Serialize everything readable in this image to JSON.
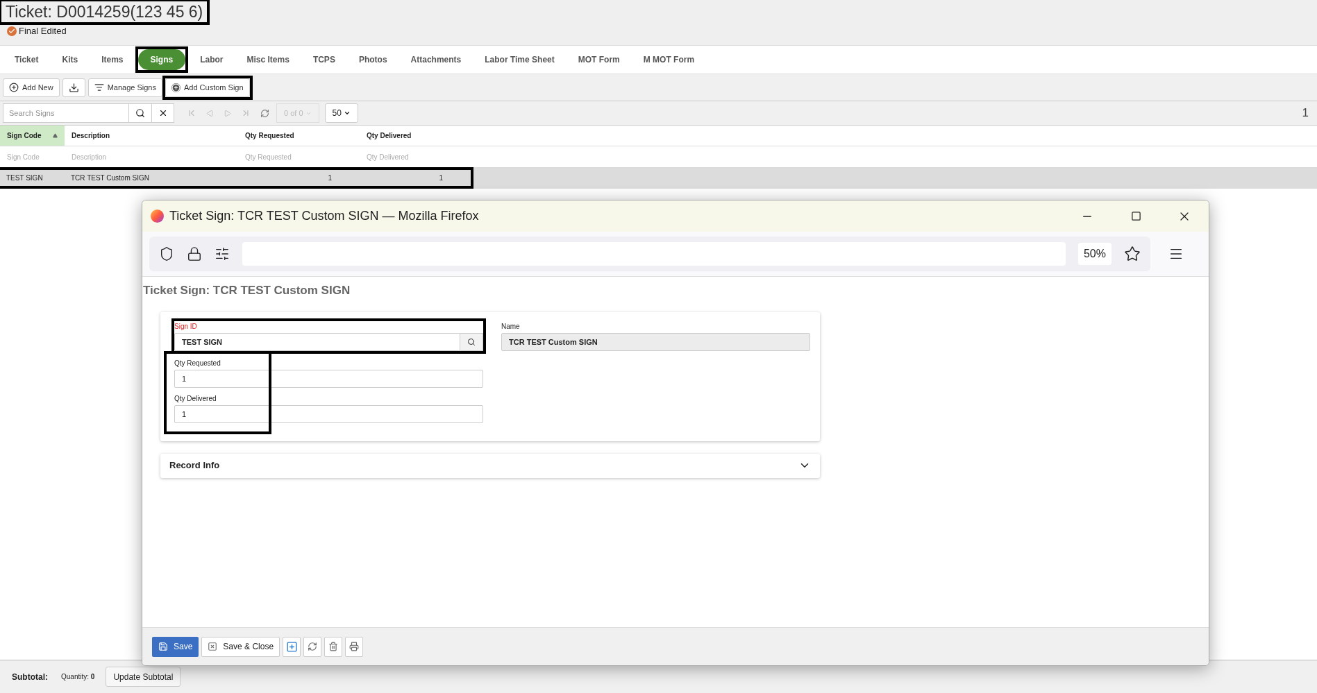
{
  "ticket": {
    "title": "Ticket: D0014259(123 45 6)",
    "highlighted": true,
    "status": "Final Edited"
  },
  "tabs": [
    {
      "label": "Ticket",
      "selected": false,
      "highlighted": false
    },
    {
      "label": "Kits",
      "selected": false,
      "highlighted": false
    },
    {
      "label": "Items",
      "selected": false,
      "highlighted": false
    },
    {
      "label": "Signs",
      "selected": true,
      "highlighted": true
    },
    {
      "label": "Labor",
      "selected": false,
      "highlighted": false
    },
    {
      "label": "Misc Items",
      "selected": false,
      "highlighted": false
    },
    {
      "label": "TCPS",
      "selected": false,
      "highlighted": false
    },
    {
      "label": "Photos",
      "selected": false,
      "highlighted": false
    },
    {
      "label": "Attachments",
      "selected": false,
      "highlighted": false
    },
    {
      "label": "Labor Time Sheet",
      "selected": false,
      "highlighted": false
    },
    {
      "label": "MOT Form",
      "selected": false,
      "highlighted": false
    },
    {
      "label": "M MOT Form",
      "selected": false,
      "highlighted": false
    }
  ],
  "toolbar": [
    {
      "kind": "add",
      "label": "Add New",
      "highlighted": false
    },
    {
      "kind": "download",
      "highlighted": false
    },
    {
      "kind": "manage",
      "label": "Manage Signs",
      "highlighted": false
    },
    {
      "kind": "add_custom",
      "label": "Add Custom Sign",
      "highlighted": true
    }
  ],
  "search": {
    "placeholder": "Search Signs"
  },
  "pager": {
    "range": "0 of 0",
    "page_size": "50",
    "page_number": "1"
  },
  "table": {
    "columns": [
      {
        "label": "Sign Code",
        "sorted": true
      },
      {
        "label": "Description",
        "sorted": false
      },
      {
        "label": "Qty Requested",
        "sorted": false
      },
      {
        "label": "Qty Delivered",
        "sorted": false
      }
    ],
    "filters": [
      {
        "placeholder": "Sign Code"
      },
      {
        "placeholder": "Description"
      },
      {
        "placeholder": "Qty Requested"
      },
      {
        "placeholder": "Qty Delivered"
      }
    ],
    "rows": [
      {
        "cells": [
          "TEST SIGN",
          "TCR TEST Custom SIGN",
          "1",
          "1"
        ],
        "selected": true,
        "highlighted": true
      }
    ]
  },
  "popup": {
    "window_title": "Ticket Sign: TCR TEST Custom SIGN — Mozilla Firefox",
    "zoom": "50%",
    "heading": "Ticket Sign: TCR TEST Custom SIGN",
    "sign_id": {
      "label": "Sign ID",
      "value": "TEST SIGN",
      "required": true,
      "highlighted": true
    },
    "name": {
      "label": "Name",
      "value": "TCR TEST Custom SIGN",
      "readonly": true
    },
    "quantities": {
      "highlighted": true,
      "fields": [
        {
          "label": "Qty Requested",
          "value": "1"
        },
        {
          "label": "Qty Delivered",
          "value": "1"
        }
      ]
    },
    "sections": [
      {
        "title": "Record Info",
        "expanded": false
      }
    ],
    "buttons": [
      {
        "kind": "save",
        "label": "Save"
      },
      {
        "kind": "save_close",
        "label": "Save & Close"
      },
      {
        "kind": "add"
      },
      {
        "kind": "refresh"
      },
      {
        "kind": "delete"
      },
      {
        "kind": "print"
      }
    ]
  },
  "footer": {
    "subtotal_label": "Subtotal:",
    "quantity_label": "Quantity:",
    "quantity": "0",
    "button": "Update Subtotal"
  }
}
